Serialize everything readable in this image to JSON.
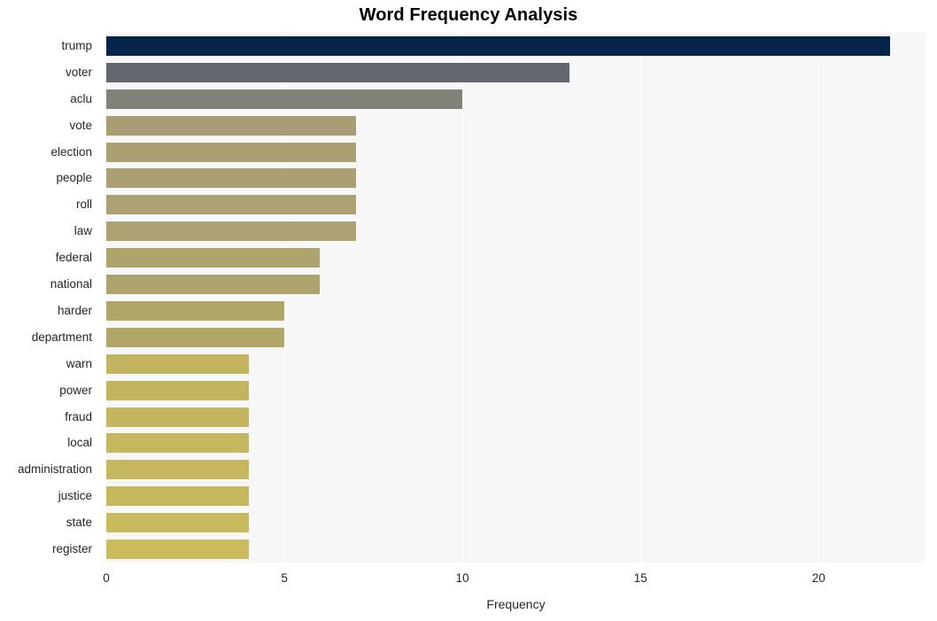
{
  "chart_data": {
    "type": "bar",
    "orientation": "horizontal",
    "title": "Word Frequency Analysis",
    "xlabel": "Frequency",
    "ylabel": "",
    "categories": [
      "trump",
      "voter",
      "aclu",
      "vote",
      "election",
      "people",
      "roll",
      "law",
      "federal",
      "national",
      "harder",
      "department",
      "warn",
      "power",
      "fraud",
      "local",
      "administration",
      "justice",
      "state",
      "register"
    ],
    "values": [
      22,
      13,
      10,
      7,
      7,
      7,
      7,
      7,
      6,
      6,
      5,
      5,
      4,
      4,
      4,
      4,
      4,
      4,
      4,
      4
    ],
    "bar_colors": [
      "#07244c",
      "#63676f",
      "#82827a",
      "#a99d73",
      "#aaa073",
      "#aaa073",
      "#aba173",
      "#aba173",
      "#ada36c",
      "#ada36c",
      "#afa668",
      "#afa668",
      "#c2b461",
      "#c3b560",
      "#c4b65f",
      "#c5b75f",
      "#c6b85e",
      "#c7b85e",
      "#c9ba5d",
      "#cbbb5c"
    ],
    "xlim": [
      0,
      23
    ],
    "xticks": [
      0,
      5,
      10,
      15,
      20
    ],
    "xtick_labels": [
      "0",
      "5",
      "10",
      "15",
      "20"
    ],
    "grid": true,
    "grid_color": "#ffffff",
    "plot_background": "#f7f7f7",
    "figure_background": "#ffffff",
    "legend": null
  }
}
